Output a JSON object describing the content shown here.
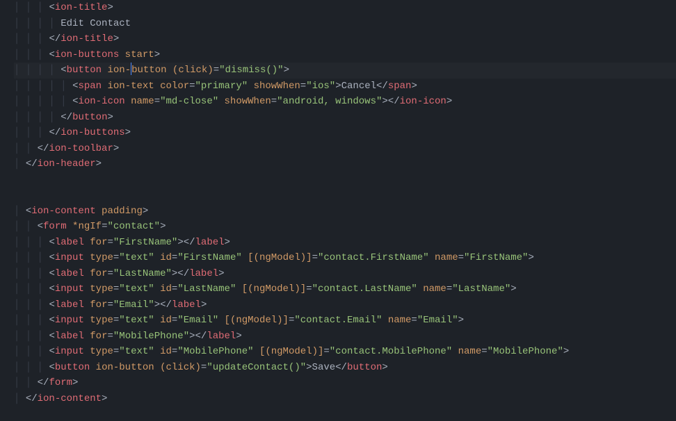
{
  "lines": [
    {
      "indent": 3,
      "seg": [
        [
          "p",
          "<"
        ],
        [
          "t",
          "ion-title"
        ],
        [
          "p",
          ">"
        ]
      ]
    },
    {
      "indent": 4,
      "seg": [
        [
          "x",
          "Edit Contact"
        ]
      ]
    },
    {
      "indent": 3,
      "seg": [
        [
          "p",
          "</"
        ],
        [
          "t",
          "ion-title"
        ],
        [
          "p",
          ">"
        ]
      ]
    },
    {
      "indent": 3,
      "seg": [
        [
          "p",
          "<"
        ],
        [
          "t",
          "ion-buttons"
        ],
        [
          "x",
          " "
        ],
        [
          "a",
          "start"
        ],
        [
          "p",
          ">"
        ]
      ]
    },
    {
      "indent": 4,
      "seg": [
        [
          "p",
          "<"
        ],
        [
          "t",
          "button"
        ],
        [
          "x",
          " "
        ],
        [
          "a",
          "ion-"
        ],
        [
          "cur",
          ""
        ],
        [
          "a",
          "button"
        ],
        [
          "x",
          " "
        ],
        [
          "a",
          "(click)"
        ],
        [
          "p",
          "="
        ],
        [
          "s",
          "\"dismiss()\""
        ],
        [
          "p",
          ">"
        ]
      ],
      "cursorLine": true
    },
    {
      "indent": 5,
      "seg": [
        [
          "p",
          "<"
        ],
        [
          "t",
          "span"
        ],
        [
          "x",
          " "
        ],
        [
          "a",
          "ion-text"
        ],
        [
          "x",
          " "
        ],
        [
          "a",
          "color"
        ],
        [
          "p",
          "="
        ],
        [
          "s",
          "\"primary\""
        ],
        [
          "x",
          " "
        ],
        [
          "a",
          "showWhen"
        ],
        [
          "p",
          "="
        ],
        [
          "s",
          "\"ios\""
        ],
        [
          "p",
          ">"
        ],
        [
          "x",
          "Cancel"
        ],
        [
          "p",
          "</"
        ],
        [
          "t",
          "span"
        ],
        [
          "p",
          ">"
        ]
      ]
    },
    {
      "indent": 5,
      "seg": [
        [
          "p",
          "<"
        ],
        [
          "t",
          "ion-icon"
        ],
        [
          "x",
          " "
        ],
        [
          "a",
          "name"
        ],
        [
          "p",
          "="
        ],
        [
          "s",
          "\"md-close\""
        ],
        [
          "x",
          " "
        ],
        [
          "a",
          "showWhen"
        ],
        [
          "p",
          "="
        ],
        [
          "s",
          "\"android, windows\""
        ],
        [
          "p",
          "></"
        ],
        [
          "t",
          "ion-icon"
        ],
        [
          "p",
          ">"
        ]
      ]
    },
    {
      "indent": 4,
      "seg": [
        [
          "p",
          "</"
        ],
        [
          "t",
          "button"
        ],
        [
          "p",
          ">"
        ]
      ]
    },
    {
      "indent": 3,
      "seg": [
        [
          "p",
          "</"
        ],
        [
          "t",
          "ion-buttons"
        ],
        [
          "p",
          ">"
        ]
      ]
    },
    {
      "indent": 2,
      "seg": [
        [
          "p",
          "</"
        ],
        [
          "t",
          "ion-toolbar"
        ],
        [
          "p",
          ">"
        ]
      ]
    },
    {
      "indent": 1,
      "seg": [
        [
          "p",
          "</"
        ],
        [
          "t",
          "ion-header"
        ],
        [
          "p",
          ">"
        ]
      ]
    },
    {
      "indent": 0,
      "seg": []
    },
    {
      "indent": 0,
      "seg": []
    },
    {
      "indent": 1,
      "seg": [
        [
          "p",
          "<"
        ],
        [
          "t",
          "ion-content"
        ],
        [
          "x",
          " "
        ],
        [
          "a",
          "padding"
        ],
        [
          "p",
          ">"
        ]
      ]
    },
    {
      "indent": 2,
      "seg": [
        [
          "p",
          "<"
        ],
        [
          "t",
          "form"
        ],
        [
          "x",
          " "
        ],
        [
          "a",
          "*ngIf"
        ],
        [
          "p",
          "="
        ],
        [
          "s",
          "\"contact\""
        ],
        [
          "p",
          ">"
        ]
      ]
    },
    {
      "indent": 3,
      "seg": [
        [
          "p",
          "<"
        ],
        [
          "t",
          "label"
        ],
        [
          "x",
          " "
        ],
        [
          "a",
          "for"
        ],
        [
          "p",
          "="
        ],
        [
          "s",
          "\"FirstName\""
        ],
        [
          "p",
          "></"
        ],
        [
          "t",
          "label"
        ],
        [
          "p",
          ">"
        ]
      ]
    },
    {
      "indent": 3,
      "seg": [
        [
          "p",
          "<"
        ],
        [
          "t",
          "input"
        ],
        [
          "x",
          " "
        ],
        [
          "a",
          "type"
        ],
        [
          "p",
          "="
        ],
        [
          "s",
          "\"text\""
        ],
        [
          "x",
          " "
        ],
        [
          "a",
          "id"
        ],
        [
          "p",
          "="
        ],
        [
          "s",
          "\"FirstName\""
        ],
        [
          "x",
          " "
        ],
        [
          "a",
          "[(ngModel)]"
        ],
        [
          "p",
          "="
        ],
        [
          "s",
          "\"contact.FirstName\""
        ],
        [
          "x",
          " "
        ],
        [
          "a",
          "name"
        ],
        [
          "p",
          "="
        ],
        [
          "s",
          "\"FirstName\""
        ],
        [
          "p",
          ">"
        ]
      ]
    },
    {
      "indent": 3,
      "seg": [
        [
          "p",
          "<"
        ],
        [
          "t",
          "label"
        ],
        [
          "x",
          " "
        ],
        [
          "a",
          "for"
        ],
        [
          "p",
          "="
        ],
        [
          "s",
          "\"LastName\""
        ],
        [
          "p",
          "></"
        ],
        [
          "t",
          "label"
        ],
        [
          "p",
          ">"
        ]
      ]
    },
    {
      "indent": 3,
      "seg": [
        [
          "p",
          "<"
        ],
        [
          "t",
          "input"
        ],
        [
          "x",
          " "
        ],
        [
          "a",
          "type"
        ],
        [
          "p",
          "="
        ],
        [
          "s",
          "\"text\""
        ],
        [
          "x",
          " "
        ],
        [
          "a",
          "id"
        ],
        [
          "p",
          "="
        ],
        [
          "s",
          "\"LastName\""
        ],
        [
          "x",
          " "
        ],
        [
          "a",
          "[(ngModel)]"
        ],
        [
          "p",
          "="
        ],
        [
          "s",
          "\"contact.LastName\""
        ],
        [
          "x",
          " "
        ],
        [
          "a",
          "name"
        ],
        [
          "p",
          "="
        ],
        [
          "s",
          "\"LastName\""
        ],
        [
          "p",
          ">"
        ]
      ]
    },
    {
      "indent": 3,
      "seg": [
        [
          "p",
          "<"
        ],
        [
          "t",
          "label"
        ],
        [
          "x",
          " "
        ],
        [
          "a",
          "for"
        ],
        [
          "p",
          "="
        ],
        [
          "s",
          "\"Email\""
        ],
        [
          "p",
          "></"
        ],
        [
          "t",
          "label"
        ],
        [
          "p",
          ">"
        ]
      ]
    },
    {
      "indent": 3,
      "seg": [
        [
          "p",
          "<"
        ],
        [
          "t",
          "input"
        ],
        [
          "x",
          " "
        ],
        [
          "a",
          "type"
        ],
        [
          "p",
          "="
        ],
        [
          "s",
          "\"text\""
        ],
        [
          "x",
          " "
        ],
        [
          "a",
          "id"
        ],
        [
          "p",
          "="
        ],
        [
          "s",
          "\"Email\""
        ],
        [
          "x",
          " "
        ],
        [
          "a",
          "[(ngModel)]"
        ],
        [
          "p",
          "="
        ],
        [
          "s",
          "\"contact.Email\""
        ],
        [
          "x",
          " "
        ],
        [
          "a",
          "name"
        ],
        [
          "p",
          "="
        ],
        [
          "s",
          "\"Email\""
        ],
        [
          "p",
          ">"
        ]
      ]
    },
    {
      "indent": 3,
      "seg": [
        [
          "p",
          "<"
        ],
        [
          "t",
          "label"
        ],
        [
          "x",
          " "
        ],
        [
          "a",
          "for"
        ],
        [
          "p",
          "="
        ],
        [
          "s",
          "\"MobilePhone\""
        ],
        [
          "p",
          "></"
        ],
        [
          "t",
          "label"
        ],
        [
          "p",
          ">"
        ]
      ]
    },
    {
      "indent": 3,
      "seg": [
        [
          "p",
          "<"
        ],
        [
          "t",
          "input"
        ],
        [
          "x",
          " "
        ],
        [
          "a",
          "type"
        ],
        [
          "p",
          "="
        ],
        [
          "s",
          "\"text\""
        ],
        [
          "x",
          " "
        ],
        [
          "a",
          "id"
        ],
        [
          "p",
          "="
        ],
        [
          "s",
          "\"MobilePhone\""
        ],
        [
          "x",
          " "
        ],
        [
          "a",
          "[(ngModel)]"
        ],
        [
          "p",
          "="
        ],
        [
          "s",
          "\"contact.MobilePhone\""
        ],
        [
          "x",
          " "
        ],
        [
          "a",
          "name"
        ],
        [
          "p",
          "="
        ],
        [
          "s",
          "\"MobilePhone\""
        ],
        [
          "p",
          ">"
        ]
      ]
    },
    {
      "indent": 3,
      "seg": [
        [
          "p",
          "<"
        ],
        [
          "t",
          "button"
        ],
        [
          "x",
          " "
        ],
        [
          "a",
          "ion-button"
        ],
        [
          "x",
          " "
        ],
        [
          "a",
          "(click)"
        ],
        [
          "p",
          "="
        ],
        [
          "s",
          "\"updateContact()\""
        ],
        [
          "p",
          ">"
        ],
        [
          "x",
          "Save"
        ],
        [
          "p",
          "</"
        ],
        [
          "t",
          "button"
        ],
        [
          "p",
          ">"
        ]
      ]
    },
    {
      "indent": 2,
      "seg": [
        [
          "p",
          "</"
        ],
        [
          "t",
          "form"
        ],
        [
          "p",
          ">"
        ]
      ]
    },
    {
      "indent": 1,
      "seg": [
        [
          "p",
          "</"
        ],
        [
          "t",
          "ion-content"
        ],
        [
          "p",
          ">"
        ]
      ]
    }
  ],
  "indentUnit": "  ",
  "guideChar": "│ "
}
